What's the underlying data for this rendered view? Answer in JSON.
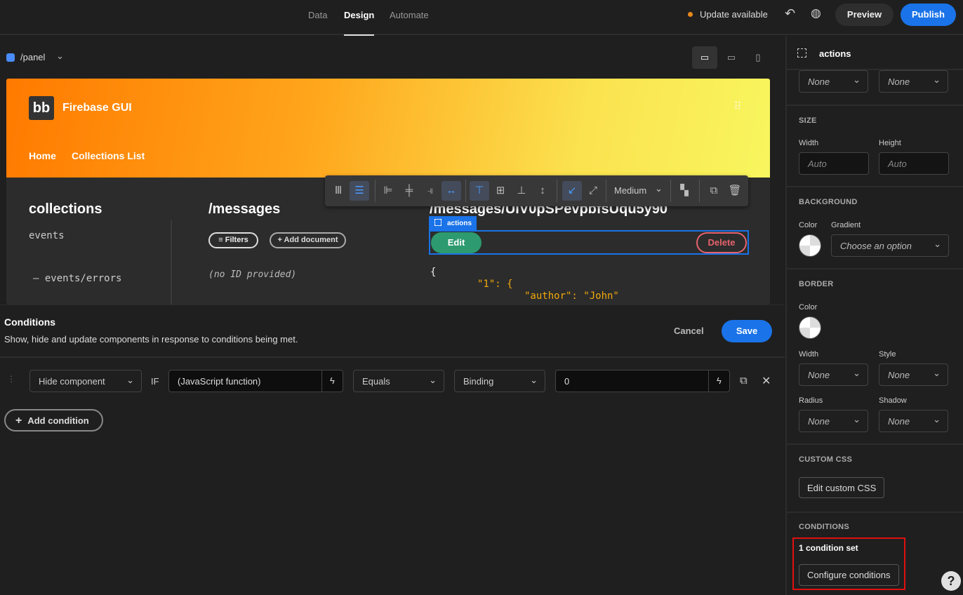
{
  "topbar": {
    "tabs": [
      {
        "label": "Data"
      },
      {
        "label": "Design",
        "active": true
      },
      {
        "label": "Automate"
      }
    ],
    "update_text": "Update available",
    "update_dot_color": "#e8891b",
    "preview": "Preview",
    "publish": "Publish",
    "accent": "#1a73e8"
  },
  "canvas": {
    "route": "/panel",
    "route_icon_color": "#4a8cff",
    "devices": [
      "desktop-icon",
      "tablet-icon",
      "mobile-icon"
    ]
  },
  "app": {
    "logo": "bb",
    "title": "Firebase GUI",
    "nav": [
      "Home",
      "Collections List"
    ],
    "collections_title": "collections",
    "collections": [
      "events",
      "– events/errors"
    ],
    "messages_title": "/messages",
    "filters": "≡ Filters",
    "add_document": "+ Add document",
    "no_id": "(no ID provided)",
    "doc_title": "/messages/UlV0pSPevpbfsUqu5y90",
    "component_tag": "actions",
    "edit": "Edit",
    "delete": "Delete",
    "json_lines": [
      "{",
      "\"1\": {",
      "\"author\": \"John\""
    ]
  },
  "toolbar": {
    "size": "Medium"
  },
  "conditions": {
    "title": "Conditions",
    "subtitle": "Show, hide and update components in response to conditions being met.",
    "cancel": "Cancel",
    "save": "Save",
    "row": {
      "action": "Hide component",
      "if": "IF",
      "value": "(JavaScript function)",
      "operator": "Equals",
      "type": "Binding",
      "reference": "0"
    },
    "add": "Add condition"
  },
  "panel": {
    "component": "actions",
    "top_dropdowns": [
      "None",
      "None"
    ],
    "size": {
      "title": "SIZE",
      "width_label": "Width",
      "height_label": "Height",
      "width": "Auto",
      "height": "Auto"
    },
    "background": {
      "title": "BACKGROUND",
      "color_label": "Color",
      "gradient_label": "Gradient",
      "gradient_value": "Choose an option"
    },
    "border": {
      "title": "BORDER",
      "color_label": "Color",
      "width_label": "Width",
      "style_label": "Style",
      "radius_label": "Radius",
      "shadow_label": "Shadow",
      "width": "None",
      "style": "None",
      "radius": "None",
      "shadow": "None"
    },
    "custom_css": {
      "title": "CUSTOM CSS",
      "button": "Edit custom CSS"
    },
    "conditions": {
      "title": "CONDITIONS",
      "status": "1 condition set",
      "button": "Configure conditions",
      "highlight_color": "#e01010"
    }
  },
  "help": "?"
}
